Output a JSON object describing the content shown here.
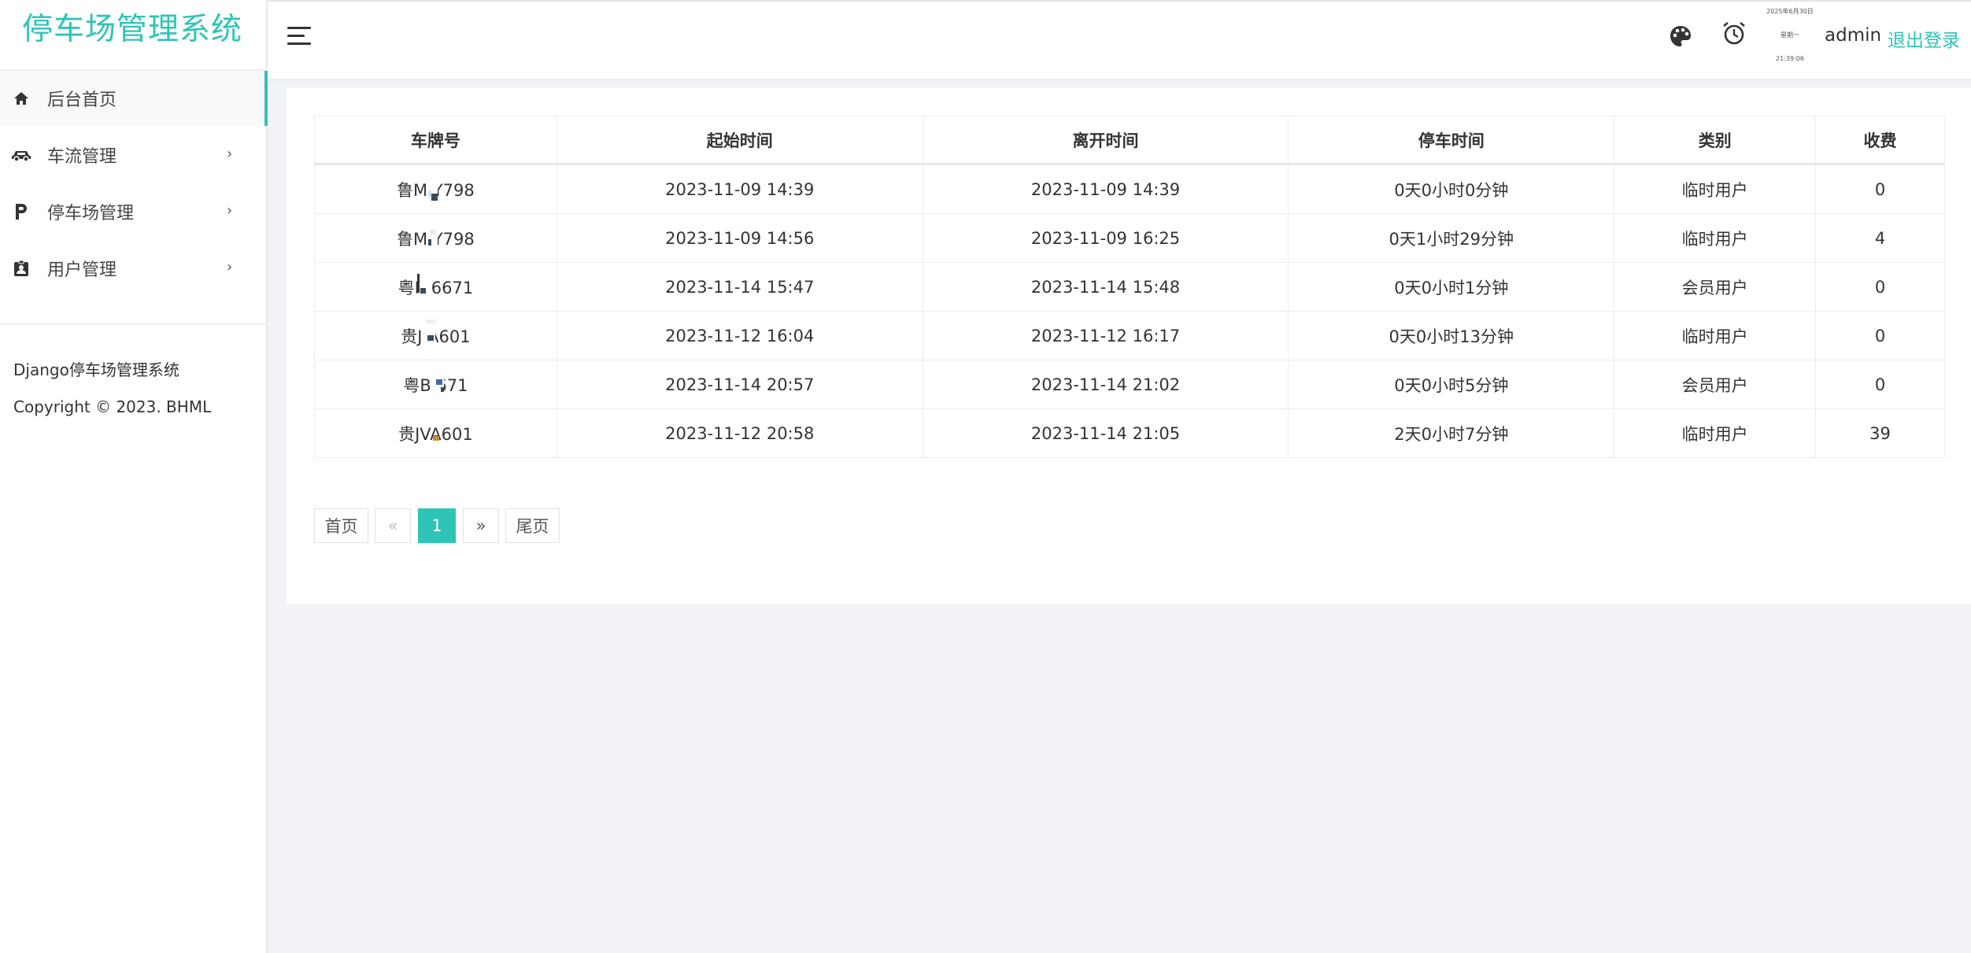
{
  "app": {
    "title": "停车场管理系统"
  },
  "sidebar": {
    "items": [
      {
        "label": "后台首页",
        "icon": "home-icon",
        "active": true
      },
      {
        "label": "车流管理",
        "icon": "car-icon",
        "arrow": "›"
      },
      {
        "label": "停车场管理",
        "icon": "parking-icon",
        "arrow": "›"
      },
      {
        "label": "用户管理",
        "icon": "user-badge-icon",
        "arrow": "›"
      }
    ],
    "footer": {
      "name": "Django停车场管理系统",
      "copyright": "Copyright © 2023. BHML"
    }
  },
  "topbar": {
    "clock": {
      "date": "2025年6月30日",
      "weekday": "星期一",
      "time": "21:39:06"
    },
    "user": "admin",
    "logout": "退出登录"
  },
  "table": {
    "headers": [
      "车牌号",
      "起始时间",
      "离开时间",
      "停车时间",
      "类别",
      "收费"
    ],
    "rows": [
      [
        "鲁M Y798",
        "2023-11-09 14:39",
        "2023-11-09 14:39",
        "0天0小时0分钟",
        "临时用户",
        "0"
      ],
      [
        "鲁M Y798",
        "2023-11-09 14:56",
        "2023-11-09 16:25",
        "0天1小时29分钟",
        "临时用户",
        "4"
      ],
      [
        "粤B 6671",
        "2023-11-14 15:47",
        "2023-11-14 15:48",
        "0天0小时1分钟",
        "会员用户",
        "0"
      ],
      [
        "贵J A601",
        "2023-11-12 16:04",
        "2023-11-12 16:17",
        "0天0小时13分钟",
        "临时用户",
        "0"
      ],
      [
        "粤B 671",
        "2023-11-14 20:57",
        "2023-11-14 21:02",
        "0天0小时5分钟",
        "会员用户",
        "0"
      ],
      [
        "贵JVA601",
        "2023-11-12 20:58",
        "2023-11-14 21:05",
        "2天0小时7分钟",
        "临时用户",
        "39"
      ]
    ]
  },
  "pagination": {
    "first": "首页",
    "prev": "«",
    "current": "1",
    "next": "»",
    "last": "尾页"
  },
  "colors": {
    "accent": "#2ec4b6",
    "background": "#f2f3f7"
  }
}
